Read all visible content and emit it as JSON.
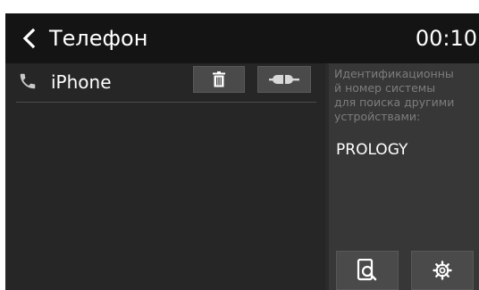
{
  "header": {
    "title": "Телефон",
    "time": "00:10",
    "back_icon": "chevron-left-icon"
  },
  "devices": [
    {
      "name": "iPhone",
      "icon": "phone-icon"
    }
  ],
  "device_actions": {
    "delete_icon": "trash-icon",
    "connect_icon": "connect-plug-icon"
  },
  "info_panel": {
    "description_lines": [
      "Идентификационны",
      "й номер системы",
      "для поиска другими",
      "устройствами:"
    ],
    "system_name": "PROLOGY",
    "search_icon": "search-device-icon",
    "settings_icon": "gear-icon"
  },
  "colors": {
    "header_bg": "#141414",
    "left_pane_bg": "#262626",
    "right_pane_bg": "#373737",
    "button_bg": "#4a4a4a",
    "muted_text": "#7d7d7d",
    "phone_icon": "#c8c8c8"
  }
}
